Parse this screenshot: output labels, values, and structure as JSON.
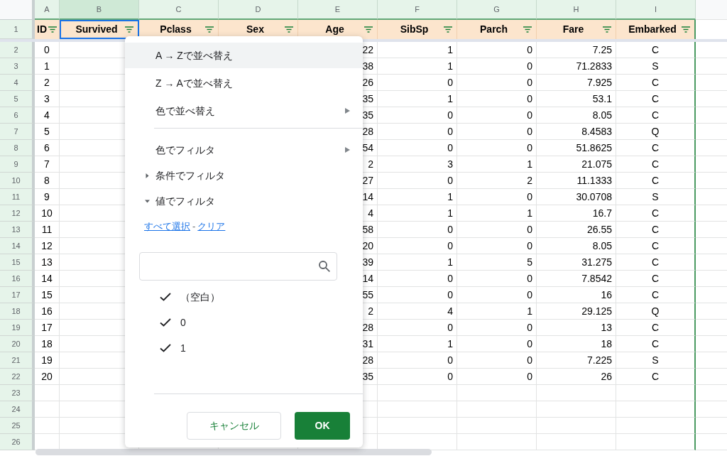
{
  "column_letters": [
    "A",
    "B",
    "C",
    "D",
    "E",
    "F",
    "G",
    "H",
    "I"
  ],
  "header_row": {
    "number": "1",
    "cells": [
      {
        "label": "ID",
        "selected": false
      },
      {
        "label": "Survived",
        "selected": true
      },
      {
        "label": "Pclass",
        "selected": false
      },
      {
        "label": "Sex",
        "selected": false
      },
      {
        "label": "Age",
        "selected": false
      },
      {
        "label": "SibSp",
        "selected": false
      },
      {
        "label": "Parch",
        "selected": false
      },
      {
        "label": "Fare",
        "selected": false
      },
      {
        "label": "Embarked",
        "selected": false
      }
    ]
  },
  "rows": [
    {
      "number": "2",
      "id": "0",
      "age": "22",
      "sibsp": "1",
      "parch": "0",
      "fare": "7.25",
      "embarked": "C"
    },
    {
      "number": "3",
      "id": "1",
      "age": "38",
      "sibsp": "1",
      "parch": "0",
      "fare": "71.2833",
      "embarked": "S"
    },
    {
      "number": "4",
      "id": "2",
      "age": "26",
      "sibsp": "0",
      "parch": "0",
      "fare": "7.925",
      "embarked": "C"
    },
    {
      "number": "5",
      "id": "3",
      "age": "35",
      "sibsp": "1",
      "parch": "0",
      "fare": "53.1",
      "embarked": "C"
    },
    {
      "number": "6",
      "id": "4",
      "age": "35",
      "sibsp": "0",
      "parch": "0",
      "fare": "8.05",
      "embarked": "C"
    },
    {
      "number": "7",
      "id": "5",
      "age": "28",
      "sibsp": "0",
      "parch": "0",
      "fare": "8.4583",
      "embarked": "Q"
    },
    {
      "number": "8",
      "id": "6",
      "age": "54",
      "sibsp": "0",
      "parch": "0",
      "fare": "51.8625",
      "embarked": "C"
    },
    {
      "number": "9",
      "id": "7",
      "age": "2",
      "sibsp": "3",
      "parch": "1",
      "fare": "21.075",
      "embarked": "C"
    },
    {
      "number": "10",
      "id": "8",
      "age": "27",
      "sibsp": "0",
      "parch": "2",
      "fare": "11.1333",
      "embarked": "C"
    },
    {
      "number": "11",
      "id": "9",
      "age": "14",
      "sibsp": "1",
      "parch": "0",
      "fare": "30.0708",
      "embarked": "S"
    },
    {
      "number": "12",
      "id": "10",
      "age": "4",
      "sibsp": "1",
      "parch": "1",
      "fare": "16.7",
      "embarked": "C"
    },
    {
      "number": "13",
      "id": "11",
      "age": "58",
      "sibsp": "0",
      "parch": "0",
      "fare": "26.55",
      "embarked": "C"
    },
    {
      "number": "14",
      "id": "12",
      "age": "20",
      "sibsp": "0",
      "parch": "0",
      "fare": "8.05",
      "embarked": "C"
    },
    {
      "number": "15",
      "id": "13",
      "age": "39",
      "sibsp": "1",
      "parch": "5",
      "fare": "31.275",
      "embarked": "C"
    },
    {
      "number": "16",
      "id": "14",
      "age": "14",
      "sibsp": "0",
      "parch": "0",
      "fare": "7.8542",
      "embarked": "C"
    },
    {
      "number": "17",
      "id": "15",
      "age": "55",
      "sibsp": "0",
      "parch": "0",
      "fare": "16",
      "embarked": "C"
    },
    {
      "number": "18",
      "id": "16",
      "age": "2",
      "sibsp": "4",
      "parch": "1",
      "fare": "29.125",
      "embarked": "Q"
    },
    {
      "number": "19",
      "id": "17",
      "age": "28",
      "sibsp": "0",
      "parch": "0",
      "fare": "13",
      "embarked": "C"
    },
    {
      "number": "20",
      "id": "18",
      "age": "31",
      "sibsp": "1",
      "parch": "0",
      "fare": "18",
      "embarked": "C"
    },
    {
      "number": "21",
      "id": "19",
      "age": "28",
      "sibsp": "0",
      "parch": "0",
      "fare": "7.225",
      "embarked": "S"
    },
    {
      "number": "22",
      "id": "20",
      "age": "35",
      "sibsp": "0",
      "parch": "0",
      "fare": "26",
      "embarked": "C"
    }
  ],
  "empty_rows": [
    "23",
    "24",
    "25",
    "26"
  ],
  "menu": {
    "sort_items": [
      {
        "label": "A → Zで並べ替え",
        "highlighted": true,
        "submenu": false
      },
      {
        "label": "Z → Aで並べ替え",
        "highlighted": false,
        "submenu": false
      },
      {
        "label": "色で並べ替え",
        "highlighted": false,
        "submenu": true
      }
    ],
    "filter_items": [
      {
        "label": "色でフィルタ",
        "kind": "submenu"
      },
      {
        "label": "条件でフィルタ",
        "kind": "collapsible",
        "expanded": false
      },
      {
        "label": "値でフィルタ",
        "kind": "collapsible",
        "expanded": true
      }
    ],
    "select_all_link": "すべて選択",
    "link_separator": "-",
    "clear_link": "クリア",
    "values": [
      {
        "label": "（空白）",
        "checked": true
      },
      {
        "label": "0",
        "checked": true
      },
      {
        "label": "1",
        "checked": true
      }
    ],
    "cancel_button": "キャンセル",
    "ok_button": "OK"
  }
}
